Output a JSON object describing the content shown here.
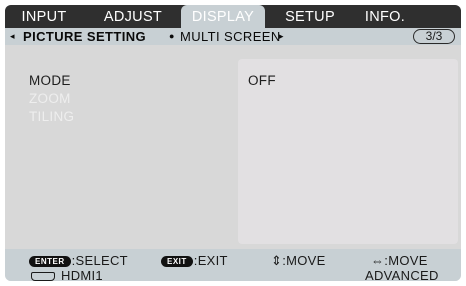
{
  "tabs": [
    {
      "label": "INPUT"
    },
    {
      "label": "ADJUST"
    },
    {
      "label": "DISPLAY"
    },
    {
      "label": "SETUP"
    },
    {
      "label": "INFO."
    }
  ],
  "submenu": {
    "left_arrow": "◂",
    "current": "PICTURE SETTING",
    "separator": "●",
    "next": "MULTI SCREEN",
    "right_arrow": "▸",
    "page": "3/3"
  },
  "menu_items": [
    {
      "label": "MODE"
    },
    {
      "label": "ZOOM"
    },
    {
      "label": "TILING"
    }
  ],
  "value": "OFF",
  "footer": {
    "enter_key": "ENTER",
    "enter_text": ":SELECT",
    "exit_key": "EXIT",
    "exit_text": ":EXIT",
    "move_ud": "⇕:MOVE",
    "move_lr": "⇔:MOVE",
    "input_name": "HDMI1",
    "level": "ADVANCED"
  },
  "colors": {
    "tab_bar": "#2f2f2f",
    "active_tab": "#c8d0d4",
    "accent_text": "#ffffff"
  }
}
